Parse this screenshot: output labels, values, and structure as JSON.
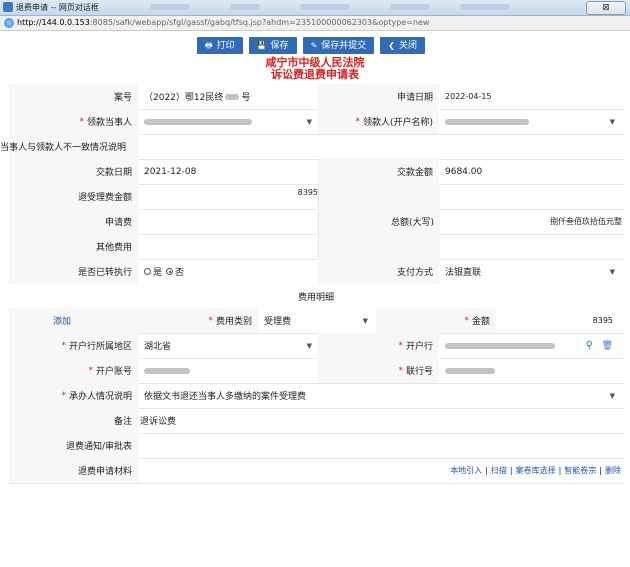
{
  "window": {
    "title": "退费申请 -- 网页对话框",
    "close_label": "⊠"
  },
  "address": {
    "host": "http://144.0.0.153",
    "path": ":8085/safk/webapp/sfgl/gassf/gabq/tfsq.jsp?ahdm=235100000062303&optype=new"
  },
  "toolbar": {
    "print": "打印",
    "save": "保存",
    "save_submit": "保存并提交",
    "close": "关闭"
  },
  "header": {
    "court": "咸宁市中级人民法院",
    "form_title": "诉讼费退费申请表"
  },
  "labels": {
    "case_no": "案号",
    "apply_date": "申请日期",
    "party": "领款当事人",
    "payee": "领款人(开户名称)",
    "mismatch": "当事人与领款人不一致情况说明",
    "pay_date": "交款日期",
    "pay_amount": "交款金额",
    "refund_fee": "退受理费金额",
    "apply_fee": "申请费",
    "total_upper": "总额(大写)",
    "other_fee": "其他费用",
    "transferred": "是否已转执行",
    "pay_method": "支付方式",
    "fee_detail": "费用明细",
    "add": "添加",
    "fee_type": "费用类别",
    "amount": "金额",
    "region": "开户行所属地区",
    "bank": "开户行",
    "account": "开户账号",
    "bank_no": "联行号",
    "handler_note": "承办人情况说明",
    "remark": "备注",
    "notice": "退费通知/审批表",
    "materials": "退费申请材料"
  },
  "values": {
    "case_no": "（2022）鄂12民终",
    "case_no_suffix": "号",
    "apply_date": "2022-04-15",
    "pay_date": "2021-12-08",
    "pay_amount": "9684.00",
    "refund_fee": "8395",
    "total_upper": "捌仟叁佰玖拾伍元整",
    "radio_yes": "是",
    "radio_no": "否",
    "pay_method": "法银直联",
    "fee_type": "受理费",
    "amount": "8395",
    "region": "湖北省",
    "handler_note": "依据文书退还当事人多缴纳的案件受理费",
    "remark": "退诉讼费"
  },
  "materials_actions": [
    "本地引入",
    "扫描",
    "案卷库选择",
    "智能卷宗",
    "删除"
  ],
  "icons": {
    "search": "search-icon",
    "delete": "trash-icon"
  },
  "colors": {
    "primary": "#2f6bb7",
    "title_red": "#e02020",
    "link": "#1a55b5"
  }
}
